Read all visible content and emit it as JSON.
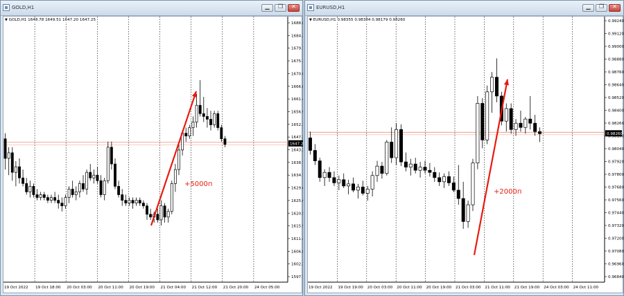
{
  "windows": {
    "gold": {
      "title": "GOLD,H1",
      "info": {
        "symbol": "GOLD,H1",
        "open": "1648.78",
        "high": "1649.51",
        "low": "1647.20",
        "close": "1647.25"
      },
      "last_price": "1647.25",
      "annotation": "+5000п",
      "colors": {
        "arrow": "#e8190f",
        "price_line": "#ee8b78",
        "candle": "#000000",
        "grid": "#000000"
      }
    },
    "eur": {
      "title": "EURUSD,H1",
      "info": {
        "symbol": "EURUSD,H1",
        "open": "0.98355",
        "high": "0.98384",
        "low": "0.98179",
        "close": "0.98260"
      },
      "last_price": "0.98260",
      "annotation": "+2000п",
      "colors": {
        "arrow": "#e8190f",
        "price_line": "#ee8b78",
        "candle": "#000000",
        "grid": "#000000"
      }
    }
  },
  "window_buttons": {
    "minimize": "▁",
    "restore": "❐",
    "close": "✕"
  },
  "chart_data": [
    {
      "type": "candlestick",
      "symbol": "GOLD,H1",
      "y_ticks": [
        "1688.80",
        "1684.20",
        "1679.70",
        "1675.10",
        "1670.60",
        "1666.00",
        "1661.40",
        "1656.90",
        "1652.30",
        "1647.25",
        "1643.20",
        "1638.70",
        "1634.10",
        "1629.60",
        "1625.00",
        "1620.50",
        "1615.90",
        "1611.40",
        "1606.80",
        "1602.30",
        "1597.70"
      ],
      "x_ticks": [
        "19 Oct 2022",
        "19 Oct 18:00",
        "20 Oct 03:00",
        "20 Oct 11:00",
        "20 Oct 19:00",
        "21 Oct 04:00",
        "21 Oct 12:00",
        "21 Oct 20:00",
        "24 Oct 05:00"
      ],
      "ylim": [
        1597.7,
        1690.5
      ],
      "current_price": 1647.25,
      "grid": "vertical-dotted",
      "annotation": {
        "text": "+5000п",
        "arrow_from_price": 1618,
        "arrow_to_price": 1666
      },
      "candles": [
        [
          1649,
          1651,
          1638,
          1642
        ],
        [
          1642,
          1646,
          1636,
          1644
        ],
        [
          1644,
          1646,
          1634,
          1637
        ],
        [
          1637,
          1641,
          1632,
          1639
        ],
        [
          1639,
          1642,
          1633,
          1635
        ],
        [
          1635,
          1638,
          1632,
          1633
        ],
        [
          1633,
          1635,
          1629,
          1630
        ],
        [
          1630,
          1634,
          1628,
          1632
        ],
        [
          1632,
          1633,
          1628,
          1629
        ],
        [
          1629,
          1631,
          1627,
          1628
        ],
        [
          1628,
          1630,
          1627,
          1629
        ],
        [
          1629,
          1630,
          1627,
          1628
        ],
        [
          1628,
          1629,
          1626,
          1627
        ],
        [
          1627,
          1629,
          1626,
          1628
        ],
        [
          1628,
          1630,
          1626,
          1627
        ],
        [
          1627,
          1629,
          1624,
          1626
        ],
        [
          1626,
          1628,
          1623,
          1625
        ],
        [
          1625,
          1629,
          1624,
          1628
        ],
        [
          1628,
          1632,
          1626,
          1631
        ],
        [
          1631,
          1634,
          1628,
          1629
        ],
        [
          1629,
          1632,
          1627,
          1630
        ],
        [
          1630,
          1634,
          1628,
          1633
        ],
        [
          1633,
          1636,
          1630,
          1631
        ],
        [
          1631,
          1638,
          1629,
          1637
        ],
        [
          1637,
          1640,
          1634,
          1635
        ],
        [
          1635,
          1638,
          1633,
          1636
        ],
        [
          1636,
          1639,
          1633,
          1634
        ],
        [
          1634,
          1636,
          1628,
          1629
        ],
        [
          1629,
          1635,
          1627,
          1634
        ],
        [
          1634,
          1648,
          1633,
          1646
        ],
        [
          1646,
          1648,
          1638,
          1640
        ],
        [
          1640,
          1642,
          1631,
          1632
        ],
        [
          1632,
          1634,
          1628,
          1629
        ],
        [
          1629,
          1631,
          1625,
          1627
        ],
        [
          1627,
          1629,
          1625,
          1626
        ],
        [
          1626,
          1628,
          1625,
          1627
        ],
        [
          1627,
          1628,
          1624,
          1626
        ],
        [
          1626,
          1628,
          1625,
          1627
        ],
        [
          1627,
          1628,
          1625,
          1626
        ],
        [
          1626,
          1627,
          1624,
          1625
        ],
        [
          1625,
          1626,
          1620,
          1622
        ],
        [
          1622,
          1624,
          1620,
          1621
        ],
        [
          1621,
          1623,
          1619,
          1622
        ],
        [
          1622,
          1624,
          1619,
          1620
        ],
        [
          1620,
          1627,
          1618,
          1625
        ],
        [
          1625,
          1626,
          1619,
          1621
        ],
        [
          1621,
          1624,
          1619,
          1623
        ],
        [
          1623,
          1634,
          1622,
          1633
        ],
        [
          1633,
          1640,
          1630,
          1638
        ],
        [
          1638,
          1647,
          1636,
          1645
        ],
        [
          1645,
          1652,
          1643,
          1651
        ],
        [
          1651,
          1653,
          1648,
          1650
        ],
        [
          1650,
          1654,
          1649,
          1653
        ],
        [
          1653,
          1657,
          1650,
          1655
        ],
        [
          1655,
          1665,
          1653,
          1661
        ],
        [
          1661,
          1670,
          1657,
          1658
        ],
        [
          1658,
          1664,
          1655,
          1657
        ],
        [
          1657,
          1660,
          1653,
          1656
        ],
        [
          1656,
          1659,
          1652,
          1654
        ],
        [
          1654,
          1659,
          1653,
          1658
        ],
        [
          1658,
          1659,
          1652,
          1653
        ],
        [
          1653,
          1654,
          1648,
          1649
        ],
        [
          1649,
          1650,
          1646,
          1647
        ]
      ]
    },
    {
      "type": "candlestick",
      "symbol": "EURUSD,H1",
      "y_ticks": [
        "0.99240",
        "0.99120",
        "0.99000",
        "0.98880",
        "0.98760",
        "0.98640",
        "0.98520",
        "0.98400",
        "0.98260",
        "0.98160",
        "0.98040",
        "0.97920",
        "0.97800",
        "0.97680",
        "0.97560",
        "0.97440",
        "0.97320",
        "0.97200",
        "0.97080",
        "0.96960",
        "0.96840"
      ],
      "x_ticks": [
        "19 Oct 2022",
        "19 Oct 19:00",
        "20 Oct 03:00",
        "20 Oct 11:00",
        "20 Oct 19:00",
        "21 Oct 03:00",
        "21 Oct 11:00",
        "21 Oct 19:00",
        "24 Oct 03:00",
        "24 Oct 11:00"
      ],
      "ylim": [
        0.9684,
        0.9934
      ],
      "current_price": 0.9826,
      "grid": "vertical-dotted",
      "annotation": {
        "text": "+2000п",
        "arrow_from_price": 0.971,
        "arrow_to_price": 0.9878
      },
      "candles": [
        [
          0.9822,
          0.9828,
          0.9806,
          0.981
        ],
        [
          0.981,
          0.9816,
          0.9796,
          0.98
        ],
        [
          0.98,
          0.9803,
          0.978,
          0.9784
        ],
        [
          0.9784,
          0.9792,
          0.9776,
          0.9789
        ],
        [
          0.9789,
          0.9794,
          0.978,
          0.9784
        ],
        [
          0.9784,
          0.979,
          0.9776,
          0.9779
        ],
        [
          0.9779,
          0.9786,
          0.9772,
          0.9782
        ],
        [
          0.9782,
          0.9788,
          0.9774,
          0.9776
        ],
        [
          0.9776,
          0.9782,
          0.9768,
          0.9778
        ],
        [
          0.9778,
          0.9784,
          0.977,
          0.9772
        ],
        [
          0.9772,
          0.9778,
          0.9764,
          0.9775
        ],
        [
          0.9775,
          0.9781,
          0.9767,
          0.9769
        ],
        [
          0.9769,
          0.9776,
          0.9762,
          0.9773
        ],
        [
          0.9773,
          0.979,
          0.9766,
          0.9786
        ],
        [
          0.9786,
          0.98,
          0.978,
          0.9795
        ],
        [
          0.9795,
          0.9799,
          0.9783,
          0.9788
        ],
        [
          0.9788,
          0.982,
          0.9786,
          0.9818
        ],
        [
          0.9818,
          0.9832,
          0.9798,
          0.9803
        ],
        [
          0.9803,
          0.9836,
          0.9796,
          0.983
        ],
        [
          0.983,
          0.9835,
          0.9795,
          0.9799
        ],
        [
          0.9799,
          0.9808,
          0.979,
          0.9794
        ],
        [
          0.9794,
          0.9802,
          0.9786,
          0.9797
        ],
        [
          0.9797,
          0.9803,
          0.9788,
          0.9791
        ],
        [
          0.9791,
          0.9799,
          0.9784,
          0.9794
        ],
        [
          0.9794,
          0.98,
          0.9788,
          0.9791
        ],
        [
          0.9791,
          0.9798,
          0.9785,
          0.9789
        ],
        [
          0.9789,
          0.9794,
          0.978,
          0.9784
        ],
        [
          0.9784,
          0.9789,
          0.9776,
          0.978
        ],
        [
          0.978,
          0.9788,
          0.9774,
          0.9785
        ],
        [
          0.9785,
          0.979,
          0.9776,
          0.9779
        ],
        [
          0.9779,
          0.9785,
          0.977,
          0.9772
        ],
        [
          0.9772,
          0.9796,
          0.9758,
          0.9764
        ],
        [
          0.9764,
          0.978,
          0.9735,
          0.9742
        ],
        [
          0.9742,
          0.9762,
          0.9736,
          0.9758
        ],
        [
          0.9758,
          0.9802,
          0.9752,
          0.9798
        ],
        [
          0.9798,
          0.9862,
          0.9792,
          0.9855
        ],
        [
          0.9855,
          0.986,
          0.9812,
          0.982
        ],
        [
          0.982,
          0.9872,
          0.9816,
          0.9866
        ],
        [
          0.9866,
          0.9885,
          0.9846,
          0.988
        ],
        [
          0.988,
          0.9898,
          0.9856,
          0.9862
        ],
        [
          0.9862,
          0.9866,
          0.9834,
          0.9838
        ],
        [
          0.9838,
          0.9855,
          0.9828,
          0.985
        ],
        [
          0.985,
          0.9855,
          0.9826,
          0.983
        ],
        [
          0.983,
          0.984,
          0.9824,
          0.9836
        ],
        [
          0.9836,
          0.9848,
          0.9828,
          0.9832
        ],
        [
          0.9832,
          0.9842,
          0.9826,
          0.984
        ],
        [
          0.984,
          0.9862,
          0.983,
          0.9836
        ],
        [
          0.9836,
          0.9844,
          0.9824,
          0.9828
        ],
        [
          0.9828,
          0.9832,
          0.9818,
          0.9826
        ]
      ]
    }
  ]
}
